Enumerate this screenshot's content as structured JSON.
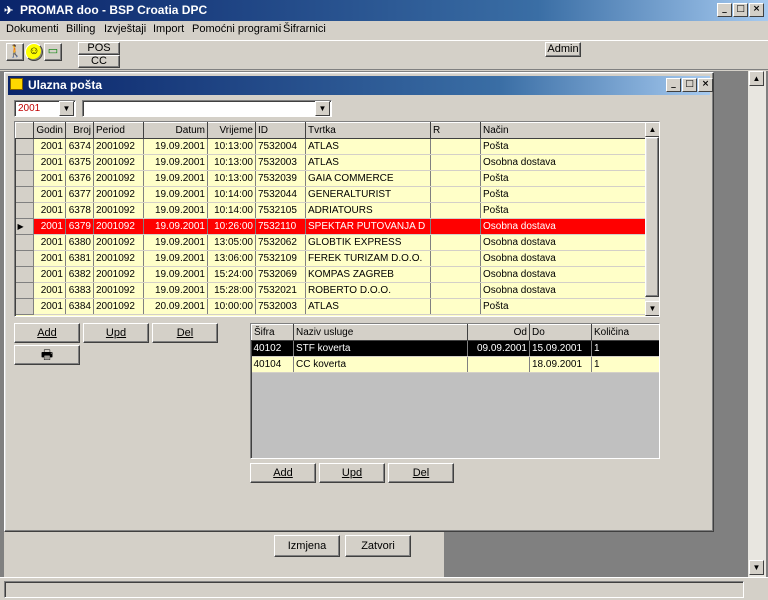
{
  "app": {
    "title": "PROMAR doo - BSP Croatia DPC",
    "min": "_",
    "max": "□",
    "close": "×"
  },
  "menu": [
    "Dokumenti",
    "Billing",
    "Izvještaji",
    "Import",
    "Pomoćni programi",
    "Šifrarnici"
  ],
  "toolbar": {
    "pos": "POS",
    "cc": "CC",
    "admin": "Admin"
  },
  "window": {
    "title": "Ulazna pošta",
    "year_value": "2001",
    "filter_value": ""
  },
  "main_table": {
    "columns": [
      "Godin",
      "Broj",
      "Period",
      "Datum",
      "Vrijeme",
      "ID",
      "Tvrtka",
      "R",
      "Način"
    ],
    "rows": [
      [
        "2001",
        "6374",
        "2001092",
        "19.09.2001",
        "10:13:00",
        "7532004",
        "ATLAS",
        "",
        "Pošta"
      ],
      [
        "2001",
        "6375",
        "2001092",
        "19.09.2001",
        "10:13:00",
        "7532003",
        "ATLAS",
        "",
        "Osobna dostava"
      ],
      [
        "2001",
        "6376",
        "2001092",
        "19.09.2001",
        "10:13:00",
        "7532039",
        "GAIA COMMERCE",
        "",
        "Pošta"
      ],
      [
        "2001",
        "6377",
        "2001092",
        "19.09.2001",
        "10:14:00",
        "7532044",
        "GENERALTURIST",
        "",
        "Pošta"
      ],
      [
        "2001",
        "6378",
        "2001092",
        "19.09.2001",
        "10:14:00",
        "7532105",
        "ADRIATOURS",
        "",
        "Pošta"
      ],
      [
        "2001",
        "6379",
        "2001092",
        "19.09.2001",
        "10:26:00",
        "7532110",
        "SPEKTAR PUTOVANJA D",
        "",
        "Osobna dostava"
      ],
      [
        "2001",
        "6380",
        "2001092",
        "19.09.2001",
        "13:05:00",
        "7532062",
        "GLOBTIK EXPRESS",
        "",
        "Osobna dostava"
      ],
      [
        "2001",
        "6381",
        "2001092",
        "19.09.2001",
        "13:06:00",
        "7532109",
        "FEREK TURIZAM D.O.O.",
        "",
        "Osobna dostava"
      ],
      [
        "2001",
        "6382",
        "2001092",
        "19.09.2001",
        "15:24:00",
        "7532069",
        "KOMPAS ZAGREB",
        "",
        "Osobna dostava"
      ],
      [
        "2001",
        "6383",
        "2001092",
        "19.09.2001",
        "15:28:00",
        "7532021",
        "ROBERTO D.O.O.",
        "",
        "Osobna dostava"
      ],
      [
        "2001",
        "6384",
        "2001092",
        "20.09.2001",
        "10:00:00",
        "7532003",
        "ATLAS",
        "",
        "Pošta"
      ]
    ],
    "selected_index": 5
  },
  "left_buttons": {
    "add": "Add",
    "upd": "Upd",
    "del": "Del"
  },
  "services_table": {
    "columns": [
      "Šifra",
      "Naziv usluge",
      "Od",
      "Do",
      "Količina"
    ],
    "rows": [
      [
        "40102",
        "STF koverta",
        "09.09.2001",
        "15.09.2001",
        "1"
      ],
      [
        "40104",
        "CC koverta",
        "",
        "18.09.2001",
        "1"
      ]
    ]
  },
  "services_buttons": {
    "add": "Add",
    "upd": "Upd",
    "del": "Del"
  },
  "bottom_buttons": {
    "izmjena": "Izmjena",
    "zatvori": "Zatvori"
  }
}
